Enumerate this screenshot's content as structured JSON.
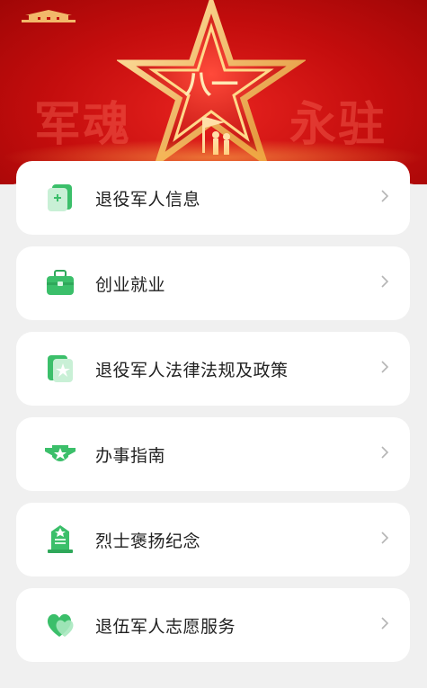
{
  "banner": {
    "slogan_left": "军魂",
    "slogan_right": "永驻"
  },
  "colors": {
    "accent_green": "#3bbf6a",
    "banner_red": "#c40d0d",
    "star_gold": "#f6c15a"
  },
  "menu": {
    "items": [
      {
        "label": "退役军人信息",
        "icon": "id-card-icon"
      },
      {
        "label": "创业就业",
        "icon": "briefcase-icon"
      },
      {
        "label": "退役军人法律法规及政策",
        "icon": "document-star-icon"
      },
      {
        "label": "办事指南",
        "icon": "military-badge-icon"
      },
      {
        "label": "烈士褒扬纪念",
        "icon": "memorial-monument-icon"
      },
      {
        "label": "退伍军人志愿服务",
        "icon": "heart-icon"
      }
    ]
  }
}
